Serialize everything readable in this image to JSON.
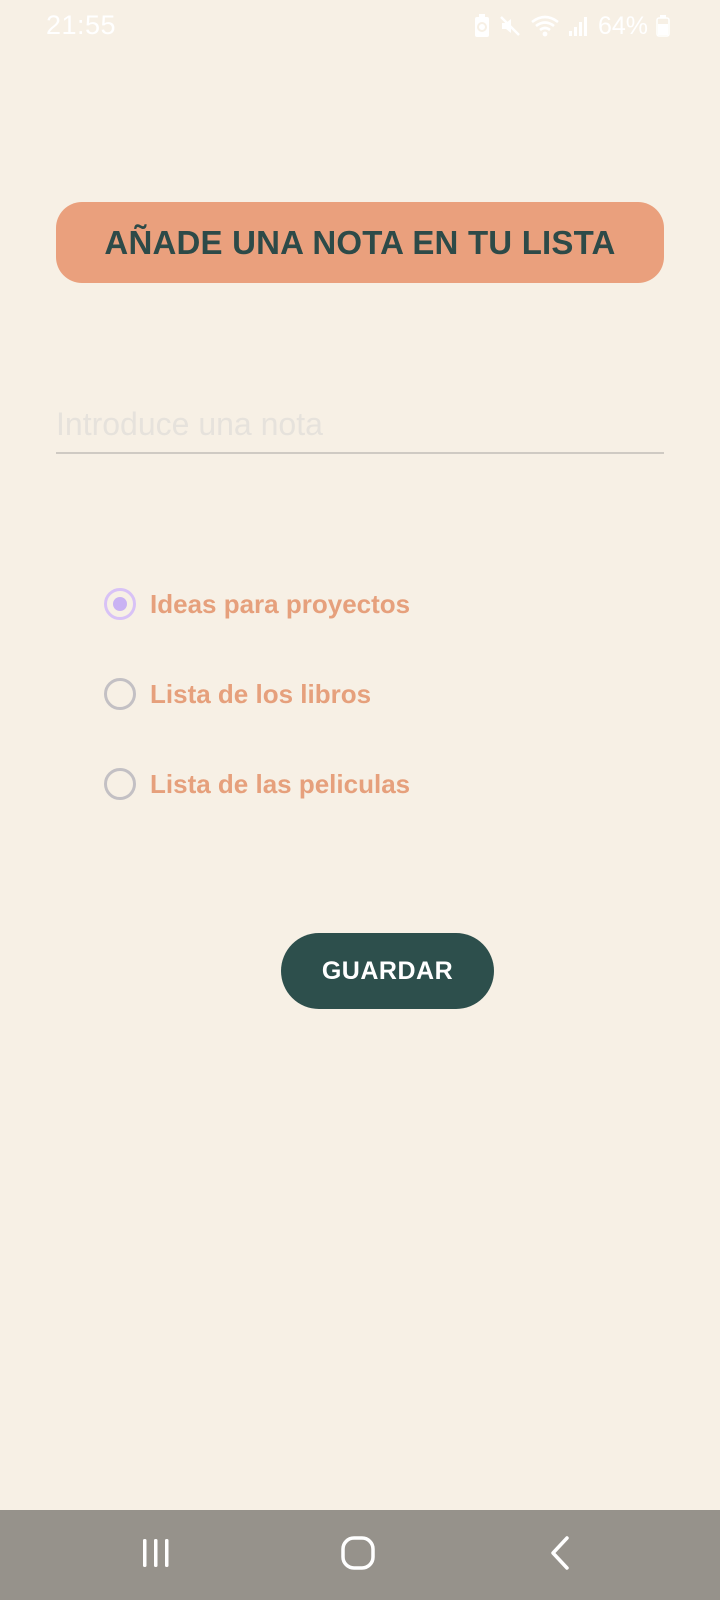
{
  "status_bar": {
    "time": "21:55",
    "battery": "64%",
    "icons": [
      "battery-saver-icon",
      "mute-icon",
      "wifi-icon",
      "signal-icon",
      "battery-icon"
    ]
  },
  "header": {
    "title": "AÑADE UNA NOTA EN TU LISTA",
    "background_color": "#eaa07d",
    "text_color": "#2d4a48"
  },
  "note_input": {
    "value": "",
    "placeholder": "Introduce una nota"
  },
  "categories": {
    "options": [
      {
        "label": "Ideas para proyectos",
        "checked": true
      },
      {
        "label": "Lista de los libros",
        "checked": false
      },
      {
        "label": "Lista de las peliculas",
        "checked": false
      }
    ],
    "label_color": "#e6a07c",
    "selected_color": "#c9b2f3"
  },
  "save_button": {
    "label": "GUARDAR",
    "background_color": "#2d4f4c"
  },
  "nav_bar": {
    "buttons": [
      "recent-apps-icon",
      "home-icon",
      "back-icon"
    ]
  },
  "theme": {
    "background": "#f7f0e5"
  }
}
